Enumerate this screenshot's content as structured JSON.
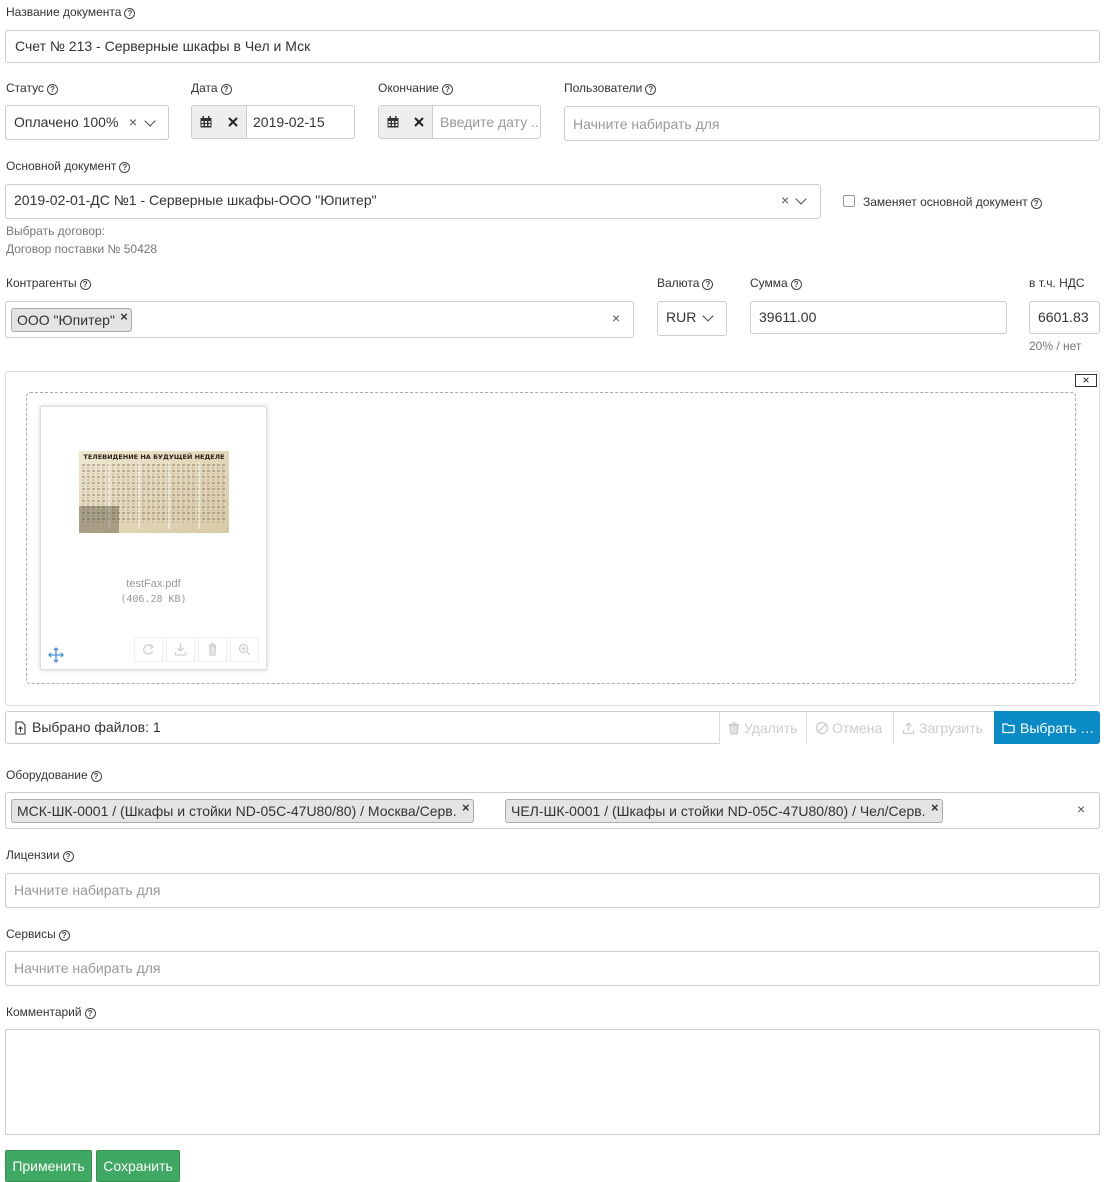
{
  "doc_name": {
    "label": "Название документа",
    "value": "Счет № 213 - Серверные шкафы в Чел и Мск"
  },
  "status": {
    "label": "Статус",
    "value": "Оплачено 100%"
  },
  "date": {
    "label": "Дата",
    "value": "2019-02-15"
  },
  "end_date": {
    "label": "Окончание",
    "placeholder": "Введите дату ..."
  },
  "users": {
    "label": "Пользователи",
    "placeholder": "Начните набирать для"
  },
  "main_doc": {
    "label": "Основной документ",
    "value": "2019-02-01-ДС №1 - Серверные шкафы-ООО \"Юпитер\"",
    "replaces_label": "Заменяет основной документ",
    "choose_contract": "Выбрать договор:",
    "contract_link": "Договор поставки № 50428"
  },
  "counterparties": {
    "label": "Контрагенты",
    "tags": [
      "ООО \"Юпитер\""
    ]
  },
  "currency": {
    "label": "Валюта",
    "value": "RUR"
  },
  "sum": {
    "label": "Сумма",
    "value": "39611.00"
  },
  "vat": {
    "label": "в т.ч. НДС",
    "value": "6601.83",
    "note": "20% / нет"
  },
  "upload": {
    "file_name": "testFax.pdf",
    "file_size": "(406.28 KB)",
    "thumb_title": "ТЕЛЕВИДЕНИЕ НА БУДУЩЕЙ НЕДЕЛЕ",
    "caption": "Выбрано файлов: 1",
    "delete_label": "Удалить",
    "cancel_label": "Отмена",
    "upload_label": "Загрузить",
    "browse_label": "Выбрать …",
    "close_glyph": "×"
  },
  "equipment": {
    "label": "Оборудование",
    "tags": [
      "МСК-ШК-0001 / (Шкафы и стойки ND-05C-47U80/80) / Москва/Серв.",
      "ЧЕЛ-ШК-0001 / (Шкафы и стойки ND-05C-47U80/80) / Чел/Серв."
    ]
  },
  "licenses": {
    "label": "Лицензии",
    "placeholder": "Начните набирать для"
  },
  "services": {
    "label": "Сервисы",
    "placeholder": "Начните набирать для"
  },
  "comment": {
    "label": "Комментарий",
    "value": ""
  },
  "buttons": {
    "apply": "Применить",
    "save": "Сохранить"
  },
  "colors": {
    "primary": "#0b8bc6",
    "success": "#3fa862"
  },
  "help_glyph": "?",
  "clear_glyph": "×"
}
